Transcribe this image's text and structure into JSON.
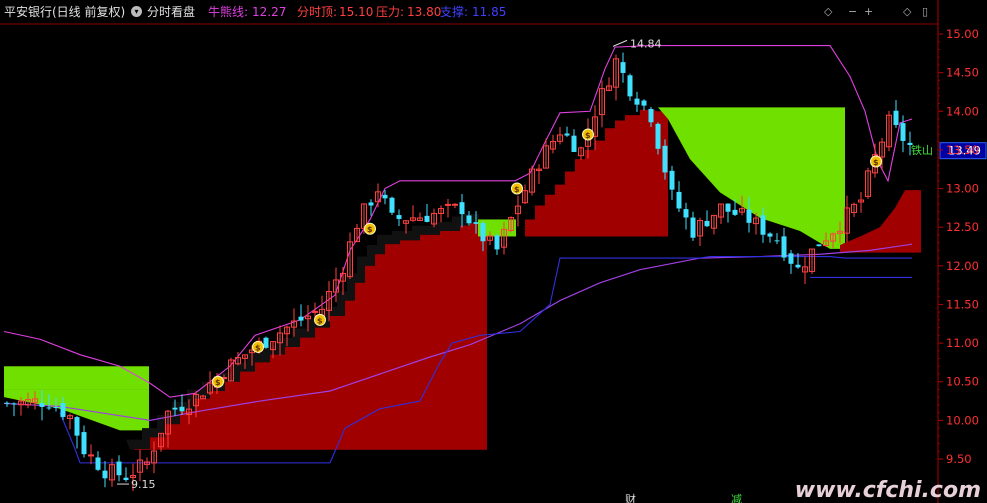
{
  "header": {
    "stock_title": "平安银行(日线 前复权)",
    "intraday_toggle": "分时看盘",
    "bull_line_label": "牛熊线:",
    "bull_line_value": "12.27",
    "intraday_top_label": "分时顶:",
    "intraday_top_value": "15.10",
    "pressure_label": "压力:",
    "pressure_value": "13.80",
    "support_label": "支撑:",
    "support_value": "11.85"
  },
  "controls": {
    "expand": "◇",
    "minus": "−",
    "plus": "+",
    "diamond": "◇",
    "settings": "▯"
  },
  "chart_data": {
    "type": "candlestick",
    "y_axis": {
      "min": 9.5,
      "max": 15.0,
      "ticks": [
        "15.00",
        "14.50",
        "14.00",
        "13.50",
        "13.00",
        "12.50",
        "12.00",
        "11.50",
        "11.00",
        "10.50",
        "10.00",
        "9.50"
      ]
    },
    "last_price_tag": "13.49",
    "annotations": {
      "high_label": "14.84",
      "low_label": "9.15",
      "signal_text": "铁山",
      "bottom_marker_left": "财",
      "bottom_marker_right": "减"
    },
    "colors": {
      "up": "#ff4040",
      "down": "#40e0ff",
      "magenta_line": "#e040e0",
      "blue_line": "#3030e0",
      "purple_line": "#a040e0",
      "red_zone": "#a00000",
      "green_zone": "#70e000"
    }
  },
  "watermark": "www.cfchi.com"
}
